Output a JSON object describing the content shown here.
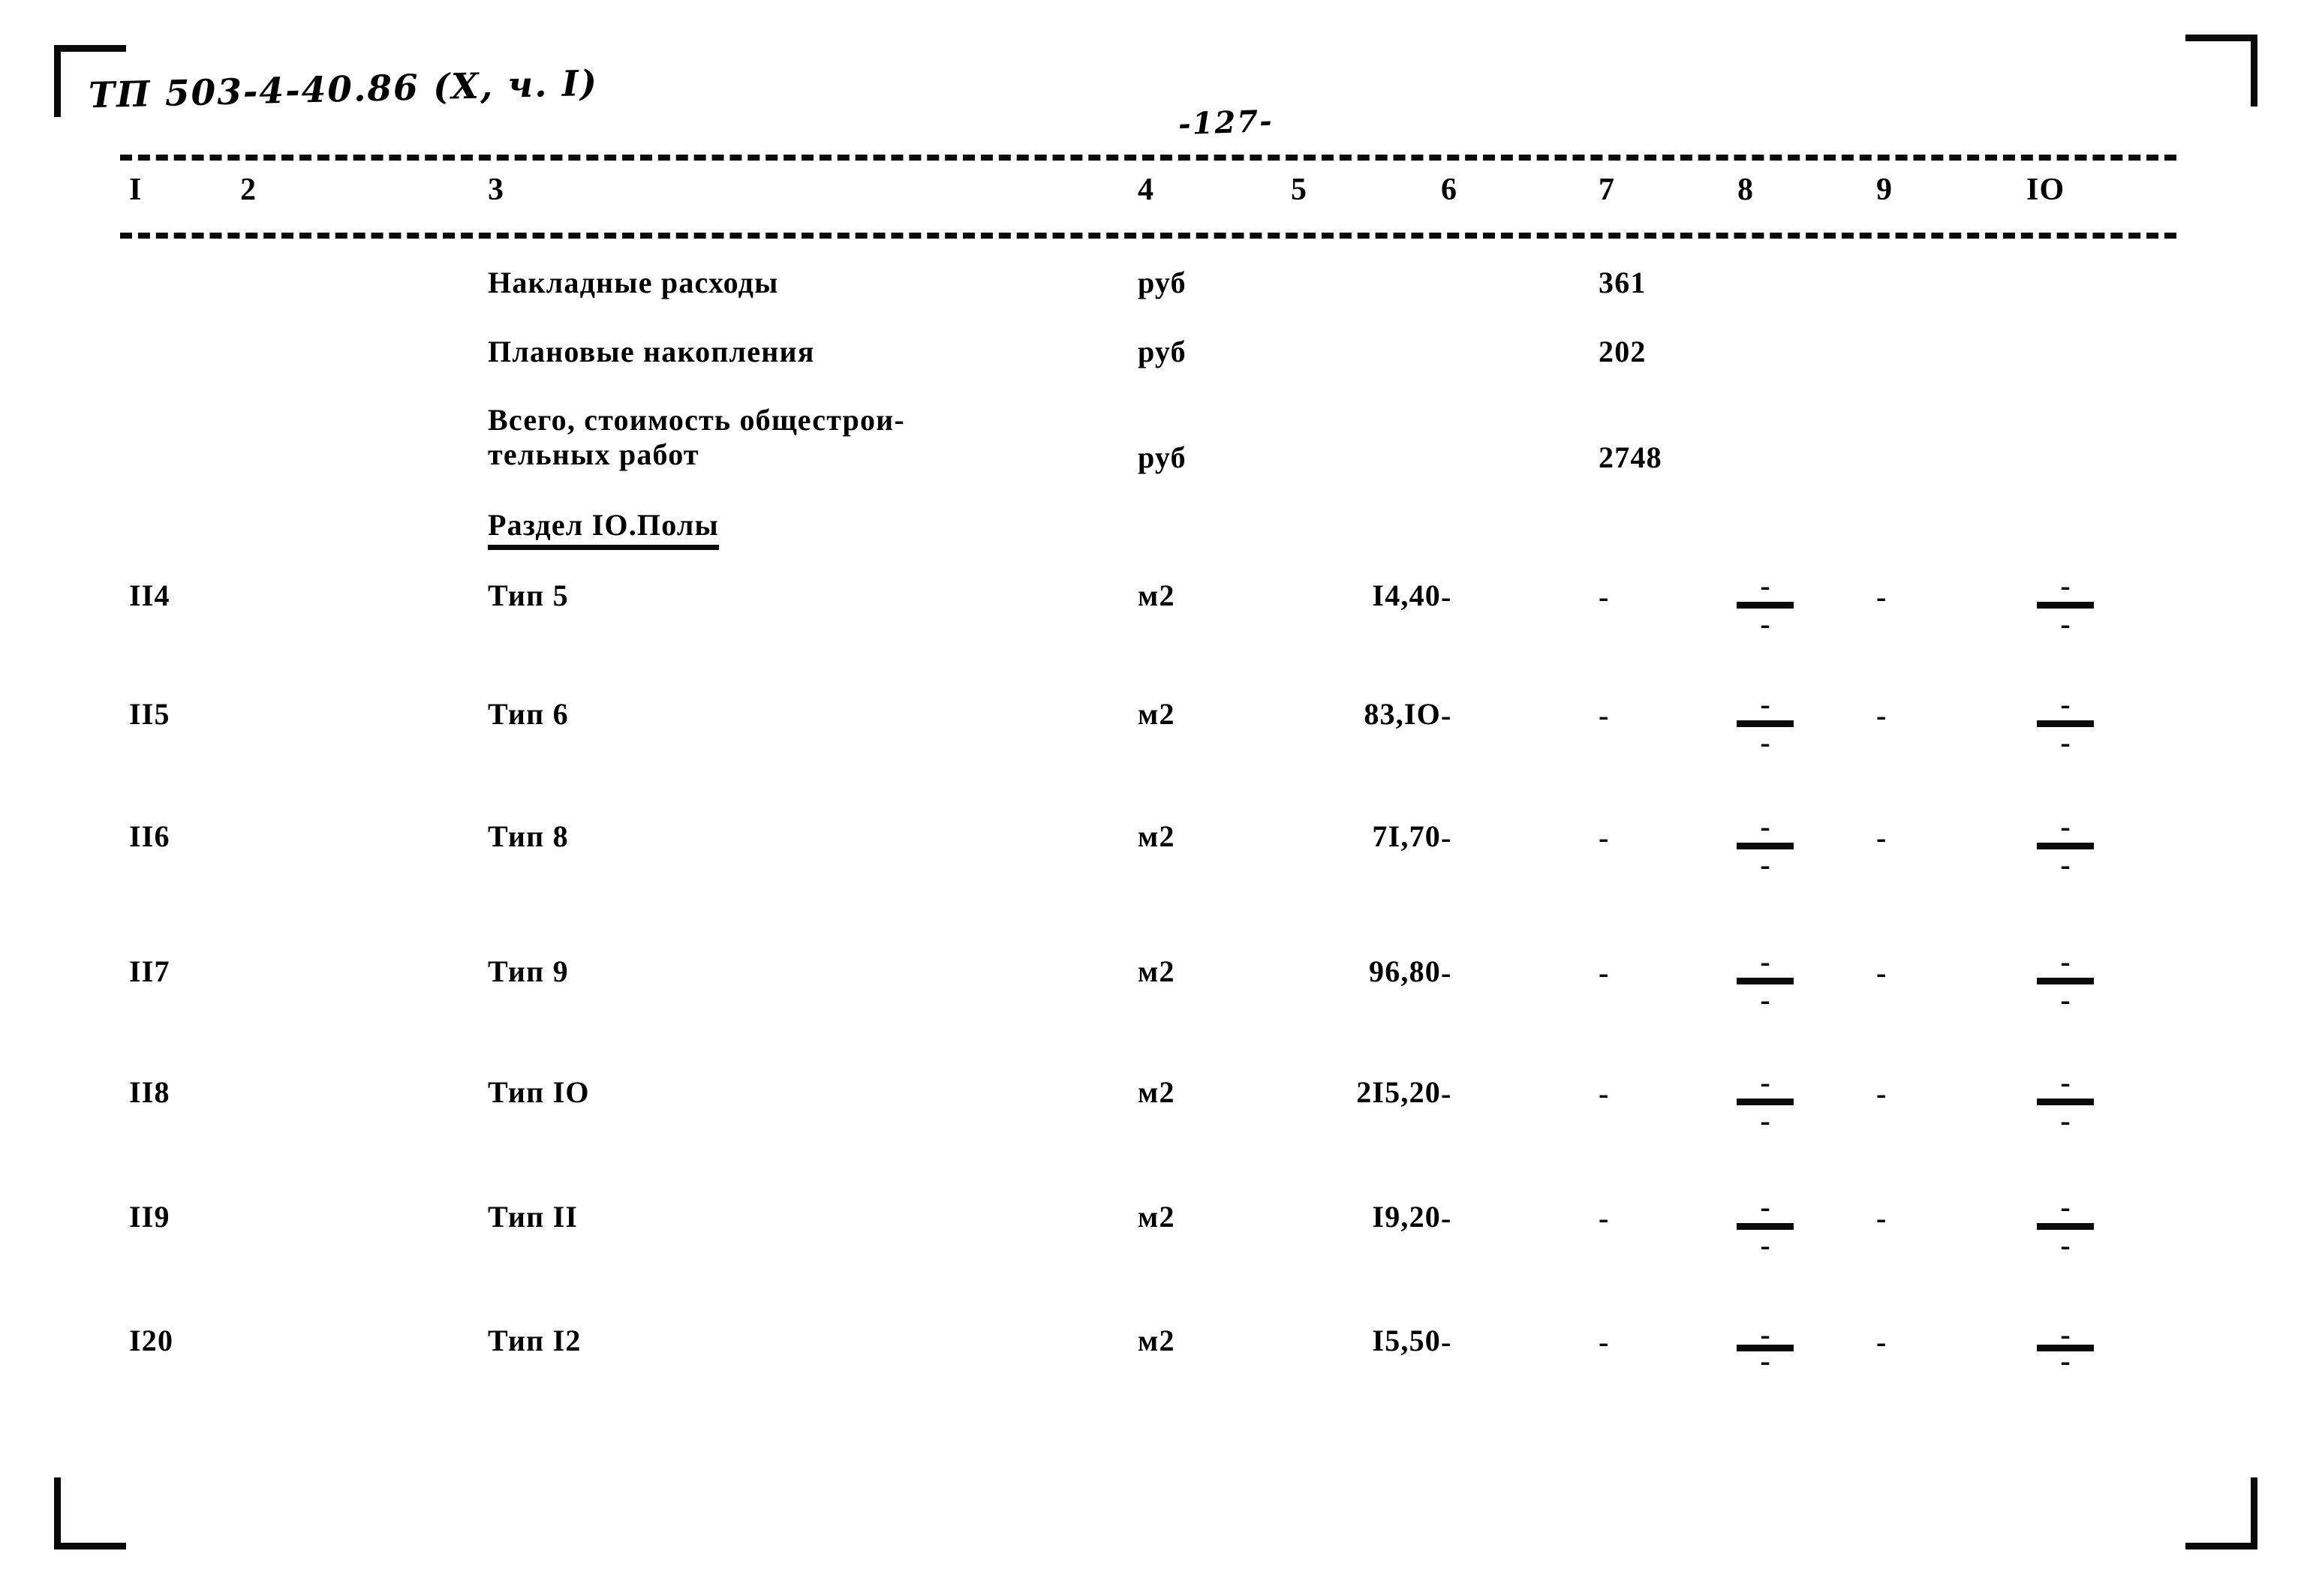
{
  "document": {
    "code_handwritten": "ТП 503-4-40.86 (X, ч. I)",
    "page_number_handwritten": "-127-"
  },
  "table": {
    "column_headers": [
      "I",
      "2",
      "3",
      "4",
      "5",
      "6",
      "7",
      "8",
      "9",
      "IO"
    ],
    "summary_rows": [
      {
        "description": "Накладные расходы",
        "unit": "руб",
        "qty": "",
        "col6": "",
        "col7": "361",
        "col8": "",
        "col9": "",
        "col10": ""
      },
      {
        "description": "Плановые накопления",
        "unit": "руб",
        "qty": "",
        "col6": "",
        "col7": "202",
        "col8": "",
        "col9": "",
        "col10": ""
      },
      {
        "description": "Всего, стоимость общестрои-\nтельных работ",
        "unit": "руб",
        "qty": "",
        "col6": "",
        "col7": "2748",
        "col8": "",
        "col9": "",
        "col10": ""
      }
    ],
    "section_heading": "Раздел IO.Полы",
    "item_rows": [
      {
        "no": "II4",
        "description": "Тип 5",
        "unit": "м2",
        "qty": "I4,40",
        "col6": "-",
        "col7": "-",
        "col8_num": "-",
        "col8_den": "-",
        "col9": "-",
        "col10_num": "-",
        "col10_den": "-"
      },
      {
        "no": "II5",
        "description": "Тип 6",
        "unit": "м2",
        "qty": "83,IO",
        "col6": "-",
        "col7": "-",
        "col8_num": "-",
        "col8_den": "-",
        "col9": "-",
        "col10_num": "-",
        "col10_den": "-"
      },
      {
        "no": "II6",
        "description": "Тип 8",
        "unit": "м2",
        "qty": "7I,70",
        "col6": "-",
        "col7": "-",
        "col8_num": "-",
        "col8_den": "-",
        "col9": "-",
        "col10_num": "-",
        "col10_den": "-"
      },
      {
        "no": "II7",
        "description": "Тип 9",
        "unit": "м2",
        "qty": "96,80",
        "col6": "-",
        "col7": "-",
        "col8_num": "-",
        "col8_den": "-",
        "col9": "-",
        "col10_num": "-",
        "col10_den": "-"
      },
      {
        "no": "II8",
        "description": "Тип  IO",
        "unit": "м2",
        "qty": "2I5,20",
        "col6": "-",
        "col7": "-",
        "col8_num": "-",
        "col8_den": "-",
        "col9": "-",
        "col10_num": "-",
        "col10_den": "-"
      },
      {
        "no": "II9",
        "description": "Тип II",
        "unit": "м2",
        "qty": "I9,20",
        "col6": "-",
        "col7": "-",
        "col8_num": "-",
        "col8_den": "-",
        "col9": "-",
        "col10_num": "-",
        "col10_den": "-"
      },
      {
        "no": "I20",
        "description": "Тип I2",
        "unit": "м2",
        "qty": "I5,50",
        "col6": "-",
        "col7": "-",
        "col8_num": "-",
        "col8_den": "-",
        "col9": "-",
        "col10_num": "-",
        "col10_den": "-"
      }
    ]
  },
  "colors": {
    "ink": "#0a0a0a",
    "paper": "#ffffff"
  }
}
